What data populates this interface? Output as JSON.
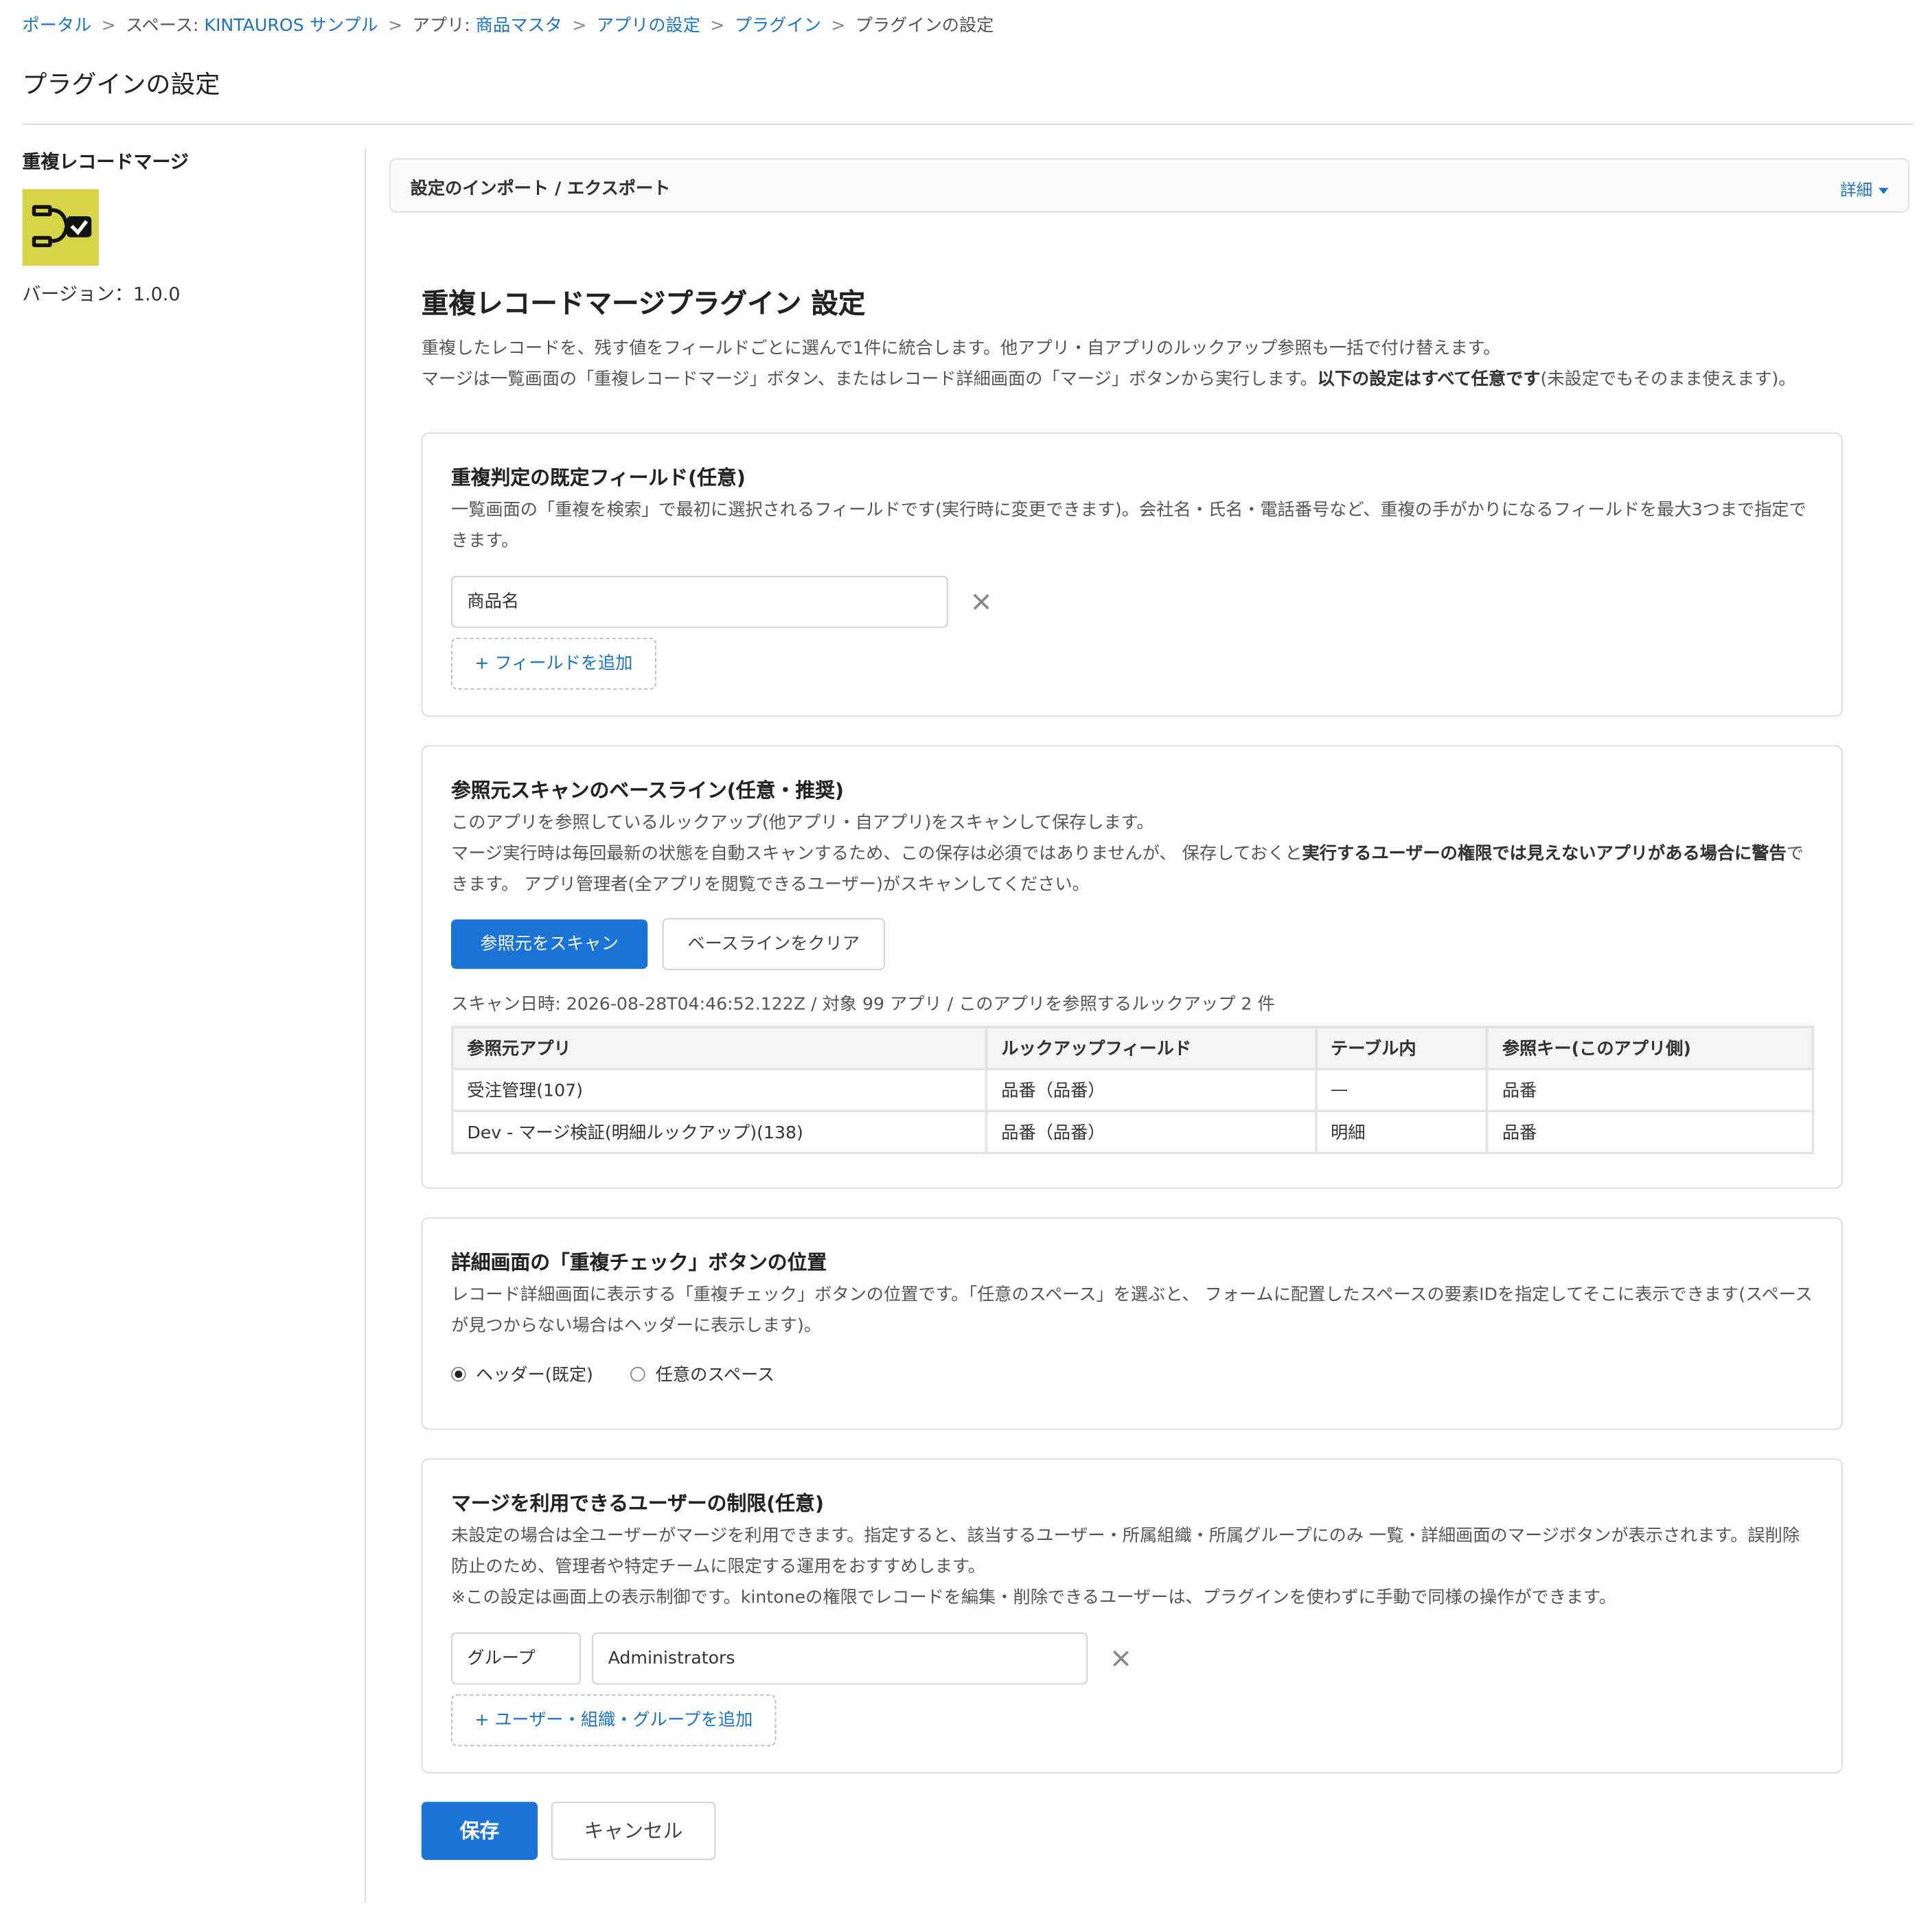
{
  "breadcrumb": {
    "portal": "ポータル",
    "space_prefix": "スペース: ",
    "space": "KINTAUROS サンプル",
    "app_prefix": "アプリ: ",
    "app": "商品マスタ",
    "app_settings": "アプリの設定",
    "plugins": "プラグイン",
    "current": "プラグインの設定",
    "separator": ">"
  },
  "page_title": "プラグインの設定",
  "sidebar": {
    "plugin_name": "重複レコードマージ",
    "version": "バージョン：1.0.0",
    "icon": "merge-records-icon"
  },
  "import_export": {
    "label": "設定のインポート / エクスポート",
    "detail": "詳細"
  },
  "main": {
    "title": "重複レコードマージプラグイン 設定",
    "desc_line1": "重複したレコードを、残す値をフィールドごとに選んで1件に統合します。他アプリ・自アプリのルックアップ参照も一括で付け替えます。",
    "desc_line2a": "マージは一覧画面の「重複レコードマージ」ボタン、またはレコード詳細画面の「マージ」ボタンから実行します。",
    "desc_line2b": "以下の設定はすべて任意です",
    "desc_line2c": "(未設定でもそのまま使えます)。"
  },
  "dup_fields": {
    "title": "重複判定の既定フィールド(任意)",
    "desc": "一覧画面の「重複を検索」で最初に選択されるフィールドです(実行時に変更できます)。会社名・氏名・電話番号など、重複の手がかりになるフィールドを最大3つまで指定できます。",
    "field_value": "商品名",
    "add_label": "+ フィールドを追加"
  },
  "scan": {
    "title": "参照元スキャンのベースライン(任意・推奨)",
    "desc_line1": "このアプリを参照しているルックアップ(他アプリ・自アプリ)をスキャンして保存します。",
    "desc_line2a": "マージ実行時は毎回最新の状態を自動スキャンするため、この保存は必須ではありませんが、 保存しておくと",
    "desc_line2b": "実行するユーザーの権限では見えないアプリがある場合に警告",
    "desc_line2c": "できます。 アプリ管理者(全アプリを閲覧できるユーザー)がスキャンしてください。",
    "scan_button": "参照元をスキャン",
    "clear_button": "ベースラインをクリア",
    "info": "スキャン日時: 2026-08-28T04:46:52.122Z / 対象 99 アプリ / このアプリを参照するルックアップ 2 件",
    "columns": [
      "参照元アプリ",
      "ルックアップフィールド",
      "テーブル内",
      "参照キー(このアプリ側)"
    ],
    "rows": [
      [
        "受注管理(107)",
        "品番（品番）",
        "—",
        "品番"
      ],
      [
        "Dev - マージ検証(明細ルックアップ)(138)",
        "品番（品番）",
        "明細",
        "品番"
      ]
    ]
  },
  "button_pos": {
    "title": "詳細画面の「重複チェック」ボタンの位置",
    "desc": "レコード詳細画面に表示する「重複チェック」ボタンの位置です。「任意のスペース」を選ぶと、 フォームに配置したスペースの要素IDを指定してそこに表示できます(スペースが見つからない場合はヘッダーに表示します)。",
    "option_header": "ヘッダー(既定)",
    "option_space": "任意のスペース",
    "selected": "header"
  },
  "users": {
    "title": "マージを利用できるユーザーの制限(任意)",
    "desc_line1": "未設定の場合は全ユーザーがマージを利用できます。指定すると、該当するユーザー・所属組織・所属グループにのみ 一覧・詳細画面のマージボタンが表示されます。誤削除防止のため、管理者や特定チームに限定する運用をおすすめします。",
    "desc_line2": "※この設定は画面上の表示制御です。kintoneの権限でレコードを編集・削除できるユーザーは、プラグインを使わずに手動で同様の操作ができます。",
    "type_value": "グループ",
    "name_value": "Administrators",
    "add_label": "+ ユーザー・組織・グループを追加"
  },
  "footer": {
    "save": "保存",
    "cancel": "キャンセル"
  },
  "colors": {
    "accent": "#1a73d6",
    "link": "#1a73c8",
    "icon_bg": "#d6d447"
  }
}
